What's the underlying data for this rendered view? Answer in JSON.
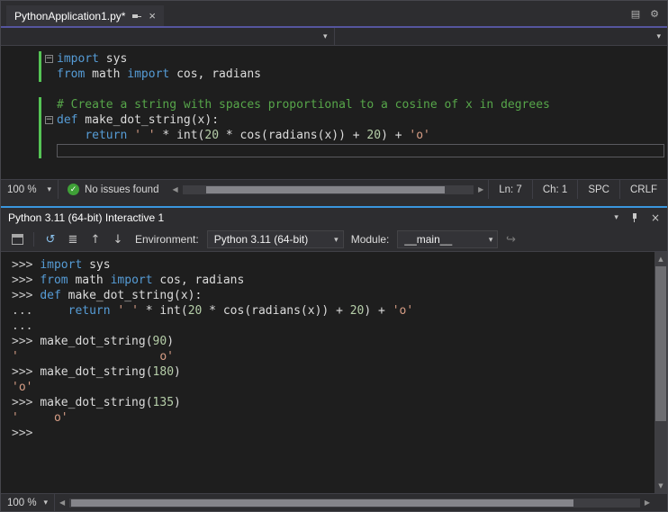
{
  "document": {
    "tab_title": "PythonApplication1.py*"
  },
  "icons": {
    "close": "×",
    "gear": "⚙",
    "window_layout": "▤",
    "chevron_down": "▾",
    "check": "✓",
    "scroll_left": "◀",
    "scroll_right": "▶",
    "scroll_up": "▲",
    "scroll_down": "▼",
    "reset": "↺",
    "clear_screen": "≣",
    "history_up": "↑",
    "history_down": "↓",
    "send_to_repl": "↪",
    "fold_open": "−"
  },
  "editor": {
    "lines": [
      {
        "fold": true,
        "changed": true,
        "tokens": [
          {
            "t": "import",
            "c": "k"
          },
          {
            "t": " sys",
            "c": "p"
          }
        ]
      },
      {
        "changed": true,
        "tokens": [
          {
            "t": "from",
            "c": "k"
          },
          {
            "t": " math ",
            "c": "p"
          },
          {
            "t": "import",
            "c": "k"
          },
          {
            "t": " cos, radians",
            "c": "p"
          }
        ]
      },
      {
        "tokens": []
      },
      {
        "changed": true,
        "tokens": [
          {
            "t": "# Create a string with spaces proportional to a cosine of x in degrees",
            "c": "c"
          }
        ]
      },
      {
        "fold": true,
        "changed": true,
        "tokens": [
          {
            "t": "def",
            "c": "k"
          },
          {
            "t": " make_dot_string(x):",
            "c": "p"
          }
        ]
      },
      {
        "changed": true,
        "tokens": [
          {
            "t": "    ",
            "c": "p"
          },
          {
            "t": "return",
            "c": "k"
          },
          {
            "t": " ",
            "c": "p"
          },
          {
            "t": "' '",
            "c": "s"
          },
          {
            "t": " * int(",
            "c": "p"
          },
          {
            "t": "20",
            "c": "n"
          },
          {
            "t": " * cos(radians(x)) + ",
            "c": "p"
          },
          {
            "t": "20",
            "c": "n"
          },
          {
            "t": ") + ",
            "c": "p"
          },
          {
            "t": "'o'",
            "c": "s"
          }
        ]
      },
      {
        "changed": true,
        "caret": true,
        "tokens": []
      }
    ]
  },
  "editor_status": {
    "zoom": "100 %",
    "no_issues": "No issues found",
    "line": "Ln: 7",
    "column": "Ch: 1",
    "spaces": "SPC",
    "line_endings": "CRLF"
  },
  "interactive": {
    "title": "Python 3.11 (64-bit) Interactive 1",
    "toolbar": {
      "environment_label": "Environment:",
      "environment_value": "Python 3.11 (64-bit)",
      "module_label": "Module:",
      "module_value": "__main__"
    },
    "lines": [
      {
        "tokens": [
          {
            "t": ">>> ",
            "c": "g"
          },
          {
            "t": "import",
            "c": "k"
          },
          {
            "t": " sys",
            "c": "p"
          }
        ]
      },
      {
        "tokens": [
          {
            "t": ">>> ",
            "c": "g"
          },
          {
            "t": "from",
            "c": "k"
          },
          {
            "t": " math ",
            "c": "p"
          },
          {
            "t": "import",
            "c": "k"
          },
          {
            "t": " cos, radians",
            "c": "p"
          }
        ]
      },
      {
        "tokens": [
          {
            "t": ">>> ",
            "c": "g"
          },
          {
            "t": "def",
            "c": "k"
          },
          {
            "t": " make_dot_string(x):",
            "c": "p"
          }
        ]
      },
      {
        "tokens": [
          {
            "t": "...     ",
            "c": "g"
          },
          {
            "t": "return",
            "c": "k"
          },
          {
            "t": " ",
            "c": "p"
          },
          {
            "t": "' '",
            "c": "s"
          },
          {
            "t": " * int(",
            "c": "p"
          },
          {
            "t": "20",
            "c": "n"
          },
          {
            "t": " * cos(radians(x)) + ",
            "c": "p"
          },
          {
            "t": "20",
            "c": "n"
          },
          {
            "t": ") + ",
            "c": "p"
          },
          {
            "t": "'o'",
            "c": "s"
          }
        ]
      },
      {
        "tokens": [
          {
            "t": "...",
            "c": "g"
          }
        ]
      },
      {
        "tokens": [
          {
            "t": ">>> ",
            "c": "g"
          },
          {
            "t": "make_dot_string(",
            "c": "p"
          },
          {
            "t": "90",
            "c": "n"
          },
          {
            "t": ")",
            "c": "p"
          }
        ]
      },
      {
        "tokens": [
          {
            "t": "'                    o'",
            "c": "s"
          }
        ]
      },
      {
        "tokens": [
          {
            "t": ">>> ",
            "c": "g"
          },
          {
            "t": "make_dot_string(",
            "c": "p"
          },
          {
            "t": "180",
            "c": "n"
          },
          {
            "t": ")",
            "c": "p"
          }
        ]
      },
      {
        "tokens": [
          {
            "t": "'o'",
            "c": "s"
          }
        ]
      },
      {
        "tokens": [
          {
            "t": ">>> ",
            "c": "g"
          },
          {
            "t": "make_dot_string(",
            "c": "p"
          },
          {
            "t": "135",
            "c": "n"
          },
          {
            "t": ")",
            "c": "p"
          }
        ]
      },
      {
        "tokens": [
          {
            "t": "'     o'",
            "c": "s"
          }
        ]
      },
      {
        "tokens": [
          {
            "t": ">>>",
            "c": "g"
          }
        ]
      }
    ],
    "status": {
      "zoom": "100 %"
    }
  }
}
